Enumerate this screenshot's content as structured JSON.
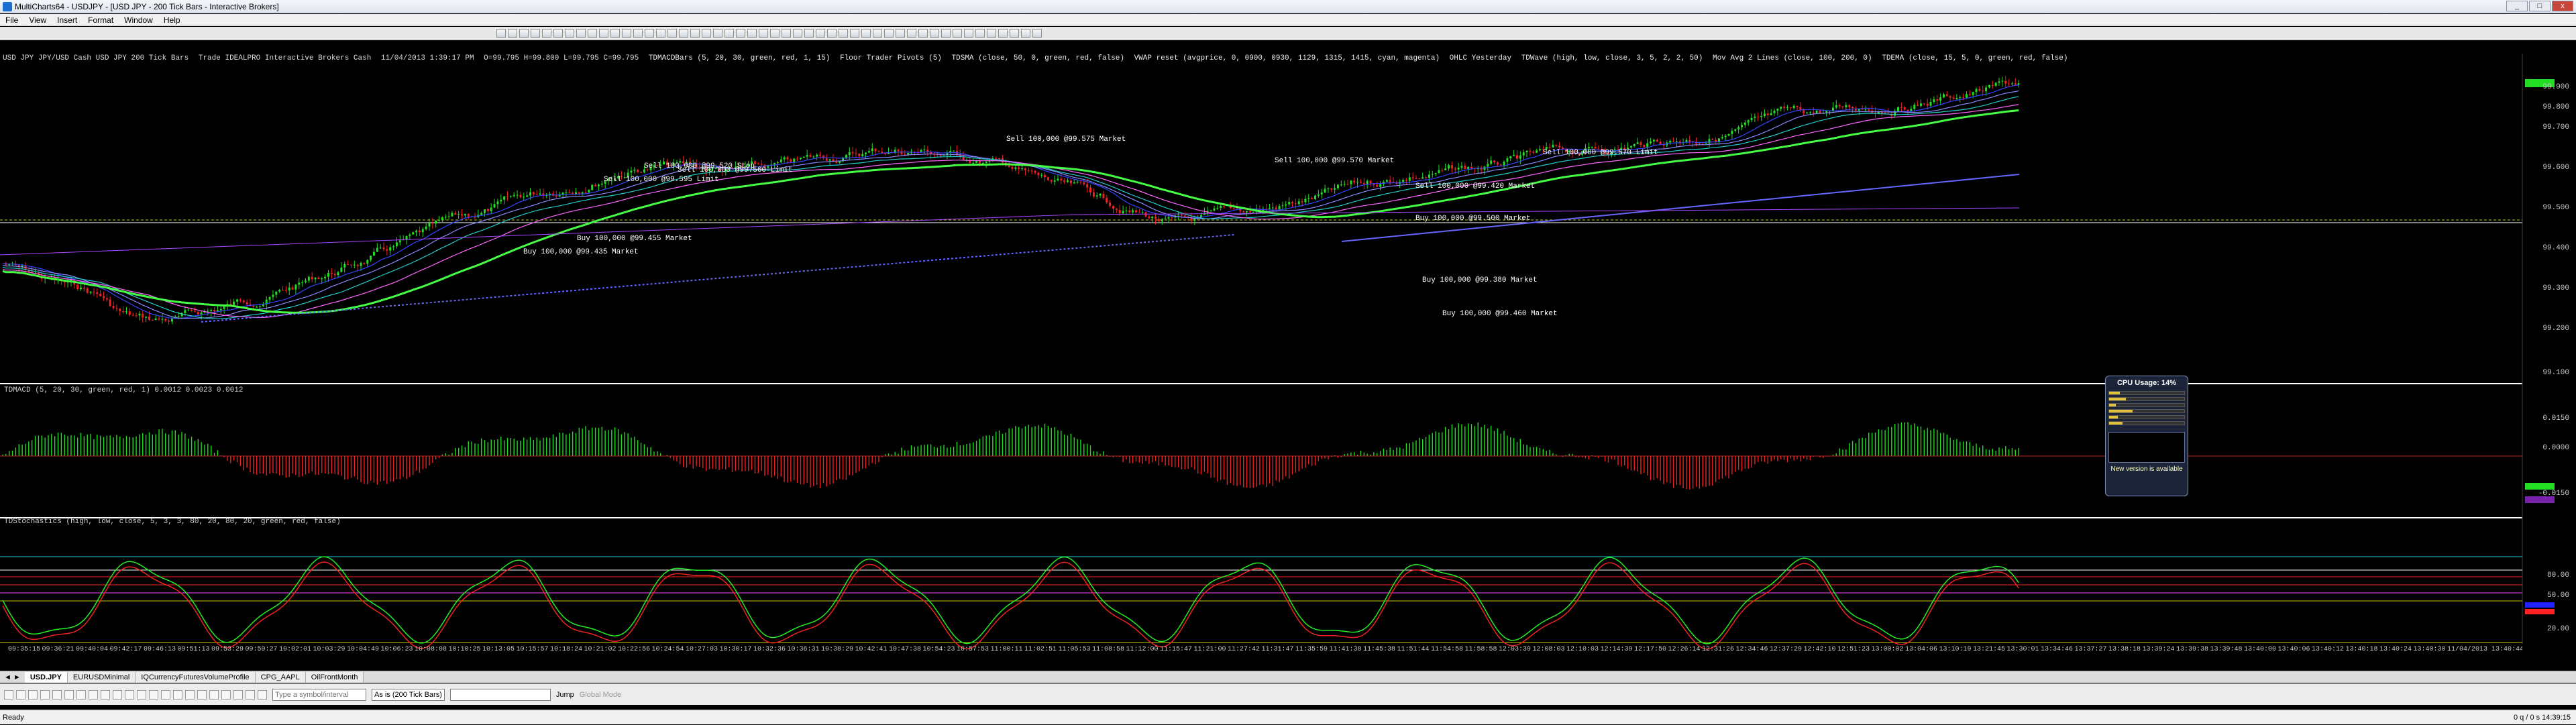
{
  "window": {
    "title": "MultiCharts64 - USDJPY - [USD JPY - 200 Tick Bars - Interactive Brokers]",
    "min": "_",
    "max": "□",
    "close": "x"
  },
  "menu": [
    "File",
    "View",
    "Insert",
    "Format",
    "Window",
    "Help"
  ],
  "statusline": {
    "symbol": "USD JPY  JPY/USD Cash  USD JPY  200 Tick Bars",
    "trade": "Trade  IDEALPRO  Interactive Brokers  Cash",
    "datetime": "11/04/2013  1:39:17 PM",
    "o": "O=99.795  H=99.800  L=99.795  C=99.795",
    "studies": [
      "TDMACDBars (5, 20, 30, green, red, 1, 15)",
      "Floor Trader Pivots (5)",
      "TDSMA (close, 50, 0, green, red, false)",
      "VWAP reset (avgprice, 0, 0900, 0930, 1129, 1315, 1415, cyan, magenta)",
      "OHLC Yesterday",
      "TDWave (high, low, close, 3, 5, 2, 2, 50)",
      "Mov Avg 2 Lines (close, 100, 200, 0)",
      "TDEMA (close, 15, 5, 0, green, red, false)"
    ]
  },
  "price_axis": [
    "99.900",
    "99.800",
    "99.700",
    "99.600",
    "99.500",
    "99.400",
    "99.300",
    "99.200",
    "99.100"
  ],
  "macd_label": "TDMACD (5, 20, 30, green, red, 1)  0.0012  0.0023  0.0012",
  "macd_axis": [
    "0.0150",
    "0.0000",
    "-0.0150"
  ],
  "stoch_label": "TDStochastics (high, low, close, 5, 3, 3, 80, 20, 80, 20, green, red, false)",
  "stoch_axis": [
    "80.00",
    "50.00",
    "20.00"
  ],
  "orders": [
    {
      "text": "Sell 100,000 @99.595 Limit"
    },
    {
      "text": "Sell 100,000 @99.520 Stop"
    },
    {
      "text": "Sell 100,000 @99.560 Limit"
    },
    {
      "text": "Sell 100,000 @99.575 Market"
    },
    {
      "text": "Buy 100,000 @99.435 Market"
    },
    {
      "text": "Buy 100,000 @99.455 Market"
    },
    {
      "text": "Sell 100,000 @99.570 Market"
    },
    {
      "text": "Sell 100,000 @99.420 Market"
    },
    {
      "text": "Buy 100,000 @99.500 Market"
    },
    {
      "text": "Sell 100,000 @99.570 Limit"
    },
    {
      "text": "Buy 100,000 @99.460 Market"
    },
    {
      "text": "Buy 100,000 @99.380 Market"
    }
  ],
  "time_axis": [
    "09:35:15",
    "09:36:21",
    "09:40:04",
    "09:42:17",
    "09:46:13",
    "09:51:13",
    "09:53:29",
    "09:59:27",
    "10:02:01",
    "10:03:29",
    "10:04:49",
    "10:06:23",
    "10:08:08",
    "10:10:25",
    "10:13:05",
    "10:15:57",
    "10:18:24",
    "10:21:02",
    "10:22:56",
    "10:24:54",
    "10:27:03",
    "10:30:17",
    "10:32:36",
    "10:36:31",
    "10:38:29",
    "10:42:41",
    "10:47:38",
    "10:54:23",
    "10:57:53",
    "11:00:11",
    "11:02:51",
    "11:05:53",
    "11:08:58",
    "11:12:00",
    "11:15:47",
    "11:21:00",
    "11:27:42",
    "11:31:47",
    "11:35:59",
    "11:41:38",
    "11:45:38",
    "11:51:44",
    "11:54:58",
    "11:58:58",
    "12:03:39",
    "12:08:03",
    "12:10:03",
    "12:14:39",
    "12:17:50",
    "12:26:14",
    "12:31:26",
    "12:34:46",
    "12:37:29",
    "12:42:10",
    "12:51:23",
    "13:00:02",
    "13:04:06",
    "13:10:19",
    "13:21:45",
    "13:30:01",
    "13:34:46",
    "13:37:27",
    "13:38:18",
    "13:39:24",
    "13:39:38",
    "13:39:48",
    "13:40:00",
    "13:40:06",
    "13:40:12",
    "13:40:18",
    "13:40:24",
    "13:40:30",
    "11/04/2013 13:40:44"
  ],
  "cpu": {
    "title": "CPU Usage: 14%",
    "footer": "New version is available"
  },
  "tabs": [
    "USD.JPY",
    "EURUSDMinimal",
    "IQCurrencyFuturesVolumeProfile",
    "CPG_AAPL",
    "OilFrontMonth"
  ],
  "drawbar": {
    "symbol_placeholder": "Type a symbol/interval",
    "interval": "As is (200 Tick Bars)",
    "jump": "Jump",
    "global": "Global Mode"
  },
  "status": {
    "left": "Ready",
    "right": "0 q / 0 s   14:39:15"
  },
  "colors": {
    "up": "#22dd22",
    "down": "#ee2222",
    "vwap": "#3344ff",
    "accent": "#cccc00"
  }
}
